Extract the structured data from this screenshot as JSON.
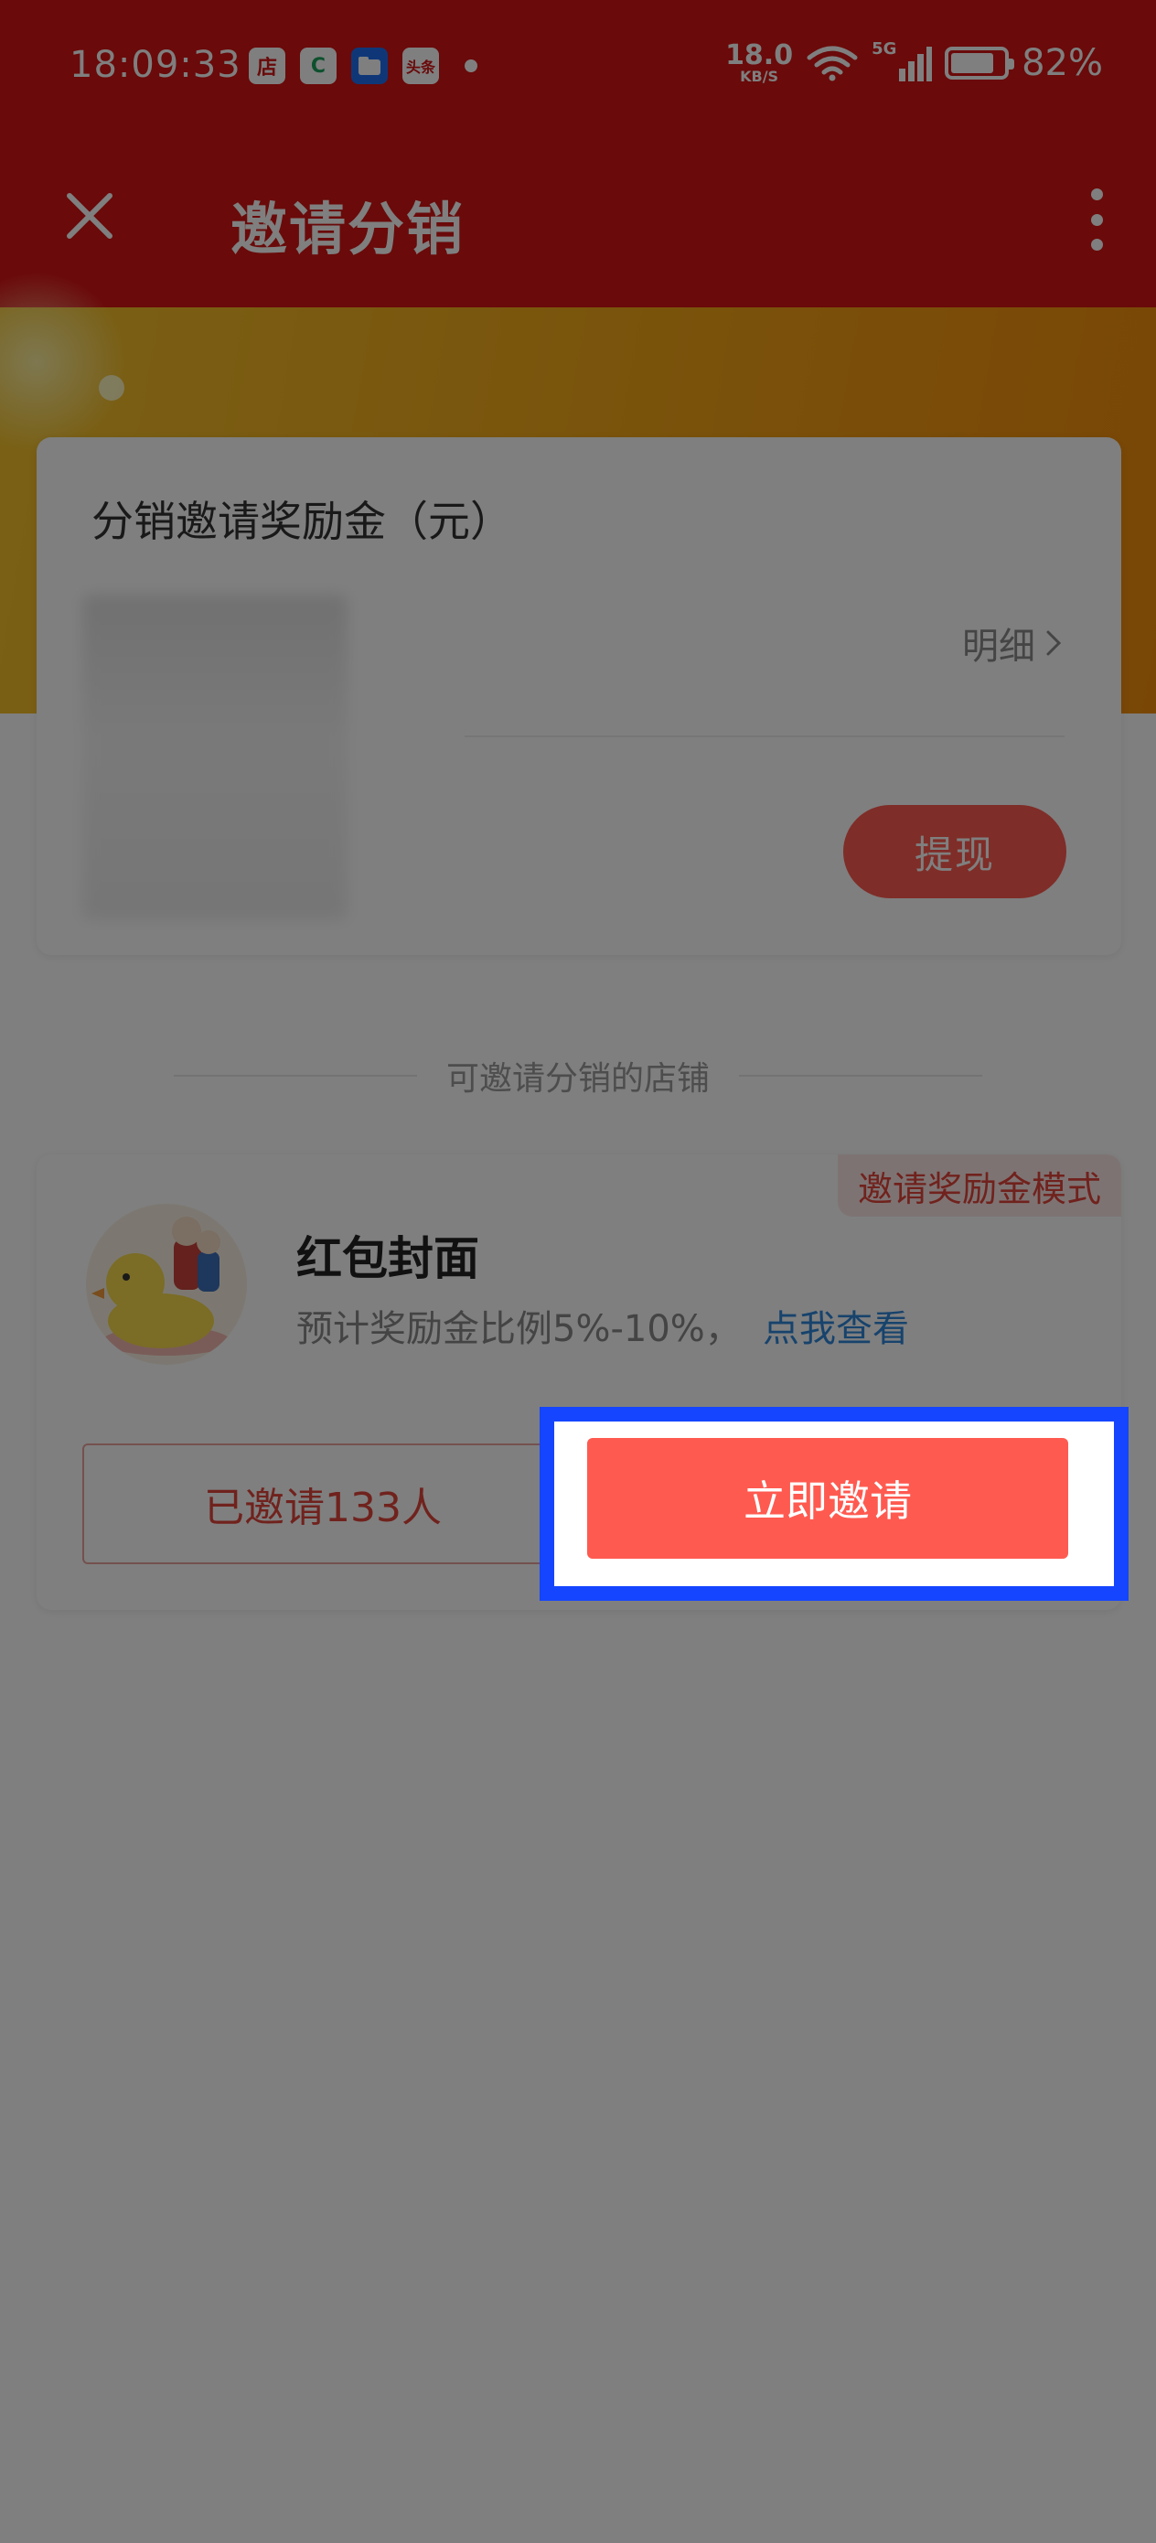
{
  "status_bar": {
    "time": "18:09:33",
    "apps": [
      "店",
      "C",
      "",
      "头条"
    ],
    "net_speed_value": "18.0",
    "net_speed_unit": "KB/S",
    "network": "5G",
    "battery": "82%",
    "battery_level": 0.82
  },
  "header": {
    "title": "邀请分销"
  },
  "reward": {
    "title": "分销邀请奖励金（元）",
    "detail_label": "明细",
    "withdraw_label": "提现"
  },
  "section": {
    "heading": "可邀请分销的店铺"
  },
  "shop": {
    "badge": "邀请奖励金模式",
    "name": "红包封面",
    "description": "预计奖励金比例5%-10%，",
    "link": "点我查看",
    "invited_label": "已邀请133人",
    "invite_label": "立即邀请"
  },
  "colors": {
    "brand_red": "#d51414",
    "button_red": "#ff5a50",
    "highlight_blue": "#1545ff",
    "link_blue": "#2f86d8",
    "banner_gold": "#f5a616"
  }
}
